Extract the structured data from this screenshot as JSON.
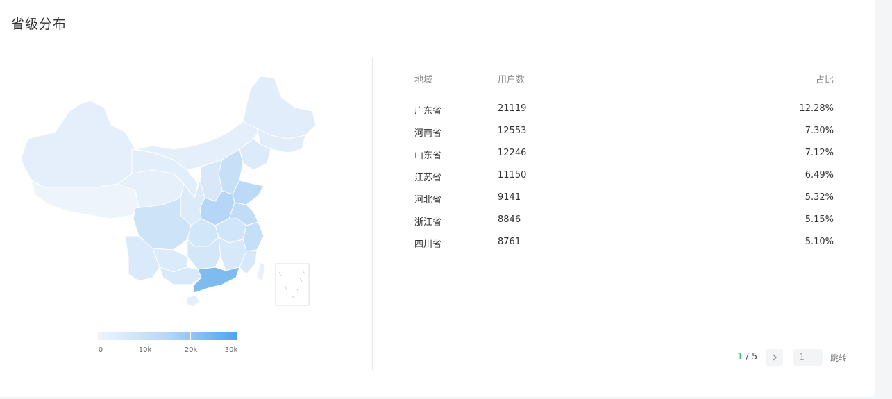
{
  "title": "省级分布",
  "legend": {
    "labels": [
      "0",
      "10k",
      "20k",
      "30k"
    ],
    "colors": [
      "#eef5fd",
      "#b6d8f6",
      "#4da3ef"
    ]
  },
  "table": {
    "headers": {
      "region": "地域",
      "users": "用户数",
      "ratio": "占比"
    },
    "rows": [
      {
        "region": "广东省",
        "users": "21119",
        "ratio": "12.28%"
      },
      {
        "region": "河南省",
        "users": "12553",
        "ratio": "7.30%"
      },
      {
        "region": "山东省",
        "users": "12246",
        "ratio": "7.12%"
      },
      {
        "region": "江苏省",
        "users": "11150",
        "ratio": "6.49%"
      },
      {
        "region": "河北省",
        "users": "9141",
        "ratio": "5.32%"
      },
      {
        "region": "浙江省",
        "users": "8846",
        "ratio": "5.15%"
      },
      {
        "region": "四川省",
        "users": "8761",
        "ratio": "5.10%"
      }
    ]
  },
  "pagination": {
    "current": "1",
    "separator": "/",
    "total": "5",
    "next_icon": "chevron-right-icon",
    "input_value": "1",
    "jump_label": "跳转"
  }
}
